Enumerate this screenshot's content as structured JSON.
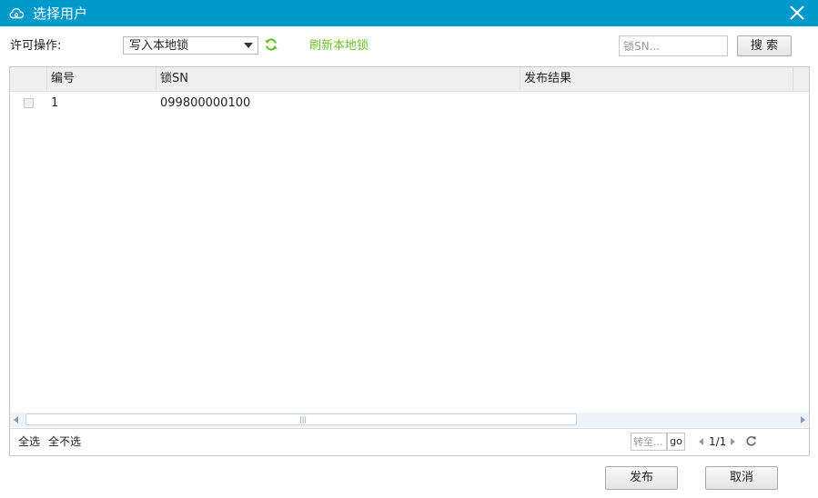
{
  "window": {
    "title": "选择用户",
    "icon": "cloud-lock-icon",
    "accent": "#0099cc"
  },
  "toolbar": {
    "label": "许可操作:",
    "operation_selected": "写入本地锁",
    "refresh_link": "刷新本地锁",
    "refresh_link_color": "#6cbf2a",
    "search_placeholder": "锁SN...",
    "search_button": "搜 索"
  },
  "table": {
    "columns": [
      "编号",
      "锁SN",
      "发布结果"
    ],
    "rows": [
      {
        "checked": false,
        "id": "1",
        "lock_sn": "099800000100",
        "result": ""
      }
    ]
  },
  "footer": {
    "select_all": "全选",
    "select_none": "全不选",
    "goto_placeholder": "转至...",
    "go_button": "go",
    "page_info": "1/1"
  },
  "actions": {
    "publish": "发布",
    "cancel": "取消"
  }
}
